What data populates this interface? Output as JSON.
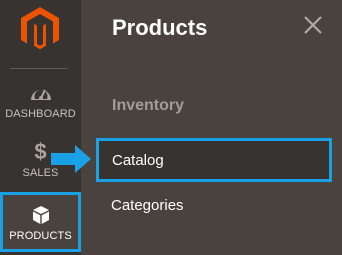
{
  "sidebar": {
    "items": [
      {
        "label": "DASHBOARD",
        "icon": "dashboard-gauge-icon"
      },
      {
        "label": "SALES",
        "icon": "dollar-icon"
      },
      {
        "label": "PRODUCTS",
        "icon": "cube-icon"
      }
    ],
    "active": "PRODUCTS"
  },
  "panel": {
    "title": "Products",
    "close_icon": "close-icon",
    "section": "Inventory",
    "items": [
      {
        "label": "Catalog"
      },
      {
        "label": "Categories"
      }
    ]
  },
  "colors": {
    "sidebar_bg": "#373330",
    "panel_bg": "#4a423e",
    "highlight": "#1aa1e5",
    "logo": "#eb5202"
  }
}
